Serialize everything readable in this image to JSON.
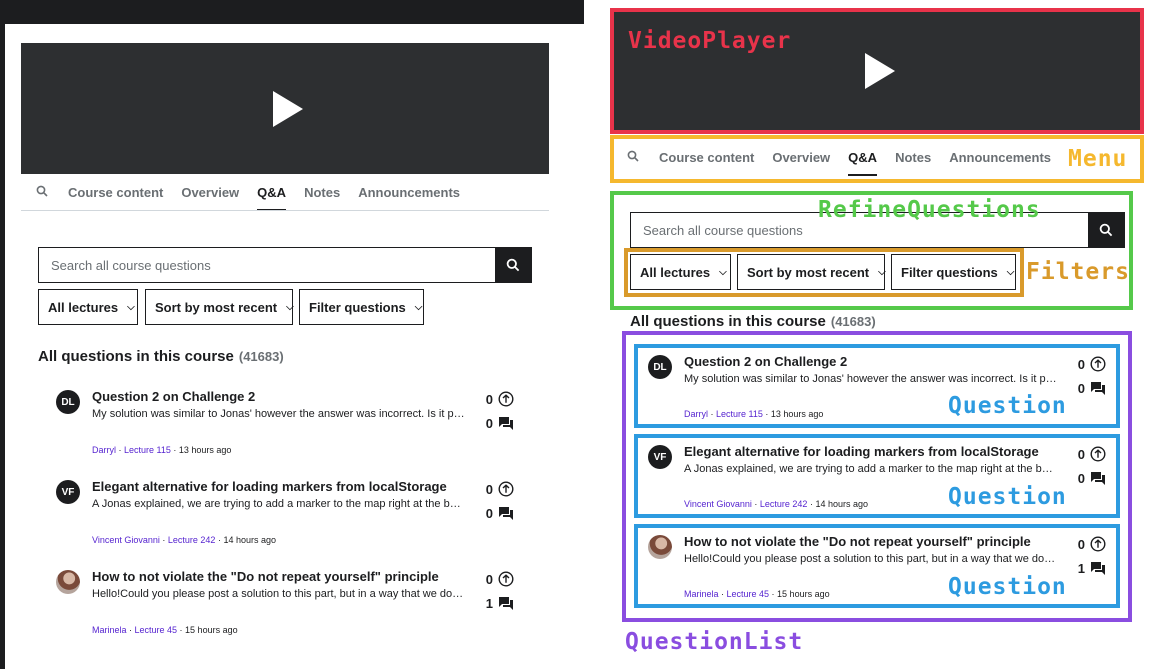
{
  "menu": {
    "items": [
      "Course content",
      "Overview",
      "Q&A",
      "Notes",
      "Announcements"
    ],
    "active": "Q&A"
  },
  "search": {
    "placeholder": "Search all course questions"
  },
  "filters": {
    "lectures": "All lectures",
    "sort": "Sort by most recent",
    "questions": "Filter questions"
  },
  "list": {
    "title": "All questions in this course",
    "count": "(41683)"
  },
  "questions": [
    {
      "avatar": "DL",
      "title": "Question 2 on Challenge 2",
      "body": "My solution was similar to Jonas' however the answer was incorrect. Is it possible someone can look at it?",
      "author": "Darryl",
      "lecture": "Lecture 115",
      "time": "13 hours ago",
      "upvotes": "0",
      "replies": "0"
    },
    {
      "avatar": "VF",
      "title": "Elegant alternative for loading markers from localStorage",
      "body": "A Jonas explained, we are trying to add a marker to the map right at the beginning of the app load.",
      "author": "Vincent Giovanni",
      "lecture": "Lecture 242",
      "time": "14 hours ago",
      "upvotes": "0",
      "replies": "0"
    },
    {
      "avatar": "",
      "title": "How to not violate the \"Do not repeat yourself\" principle",
      "body": "Hello!Could you please post a solution to this part, but in a way that we do not repeat ourselves?",
      "author": "Marinela",
      "lecture": "Lecture 45",
      "time": "15 hours ago",
      "upvotes": "0",
      "replies": "1"
    }
  ],
  "annotations": {
    "video": "VideoPlayer",
    "menu": "Menu",
    "refine": "RefineQuestions",
    "filters": "Filters",
    "question": "Question",
    "list": "QuestionList"
  },
  "colors": {
    "video": "#e8334a",
    "menu": "#f5b82e",
    "refine": "#55c94a",
    "filters": "#d99a2b",
    "question": "#2d9be0",
    "list": "#8a4de0",
    "link": "#5624d0",
    "dark": "#1c1d1f"
  }
}
